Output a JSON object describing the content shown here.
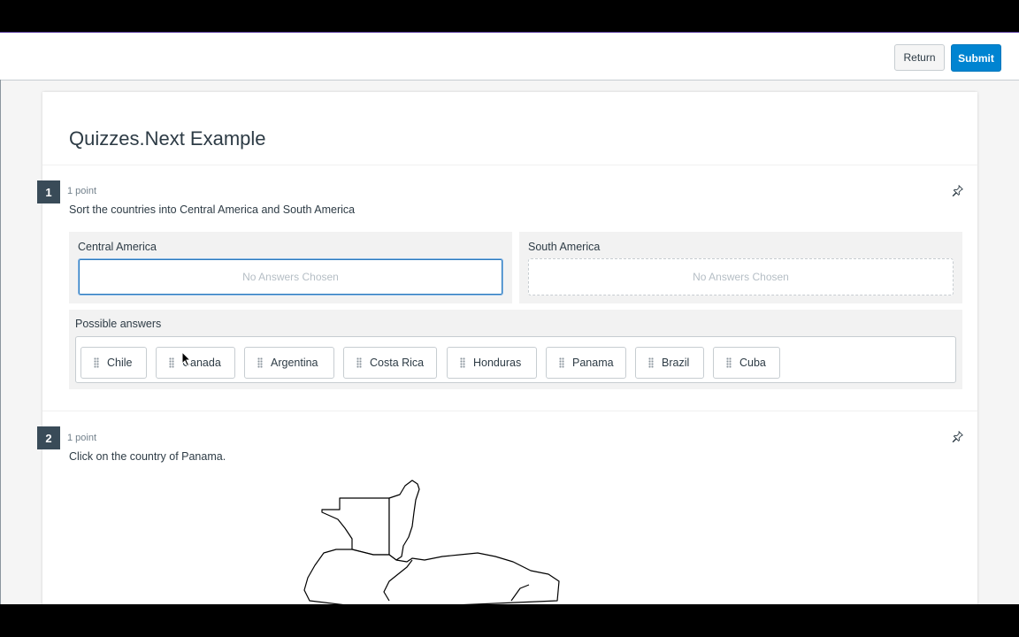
{
  "toolbar": {
    "return_label": "Return",
    "submit_label": "Submit",
    "accent_color": "#0084d1"
  },
  "quiz": {
    "title": "Quizzes.Next Example"
  },
  "questions": [
    {
      "number": "1",
      "points": "1 point",
      "prompt": "Sort the countries into Central America and South America",
      "buckets": [
        {
          "label": "Central America",
          "placeholder": "No Answers Chosen"
        },
        {
          "label": "South America",
          "placeholder": "No Answers Chosen"
        }
      ],
      "possible_answers_label": "Possible answers",
      "answers": [
        "Chile",
        "Canada",
        "Argentina",
        "Costa Rica",
        "Honduras",
        "Panama",
        "Brazil",
        "Cuba"
      ]
    },
    {
      "number": "2",
      "points": "1 point",
      "prompt": "Click on the country of Panama."
    }
  ],
  "icons": {
    "pin": "pin-icon",
    "grip": "drag-handle-icon",
    "cursor": "mouse-pointer-icon"
  }
}
